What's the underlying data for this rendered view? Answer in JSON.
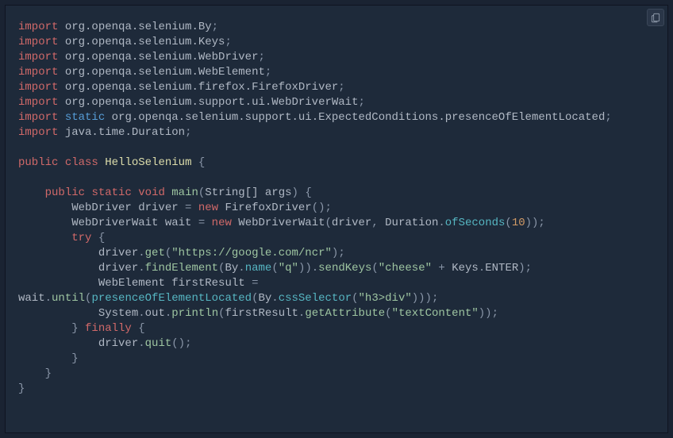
{
  "code": {
    "lines": [
      [
        {
          "c": "kw",
          "t": "import"
        },
        {
          "c": "pn",
          "t": " "
        },
        {
          "c": "pkg",
          "t": "org.openqa.selenium.By"
        },
        {
          "c": "pn",
          "t": ";"
        }
      ],
      [
        {
          "c": "kw",
          "t": "import"
        },
        {
          "c": "pn",
          "t": " "
        },
        {
          "c": "pkg",
          "t": "org.openqa.selenium.Keys"
        },
        {
          "c": "pn",
          "t": ";"
        }
      ],
      [
        {
          "c": "kw",
          "t": "import"
        },
        {
          "c": "pn",
          "t": " "
        },
        {
          "c": "pkg",
          "t": "org.openqa.selenium.WebDriver"
        },
        {
          "c": "pn",
          "t": ";"
        }
      ],
      [
        {
          "c": "kw",
          "t": "import"
        },
        {
          "c": "pn",
          "t": " "
        },
        {
          "c": "pkg",
          "t": "org.openqa.selenium.WebElement"
        },
        {
          "c": "pn",
          "t": ";"
        }
      ],
      [
        {
          "c": "kw",
          "t": "import"
        },
        {
          "c": "pn",
          "t": " "
        },
        {
          "c": "pkg",
          "t": "org.openqa.selenium.firefox.FirefoxDriver"
        },
        {
          "c": "pn",
          "t": ";"
        }
      ],
      [
        {
          "c": "kw",
          "t": "import"
        },
        {
          "c": "pn",
          "t": " "
        },
        {
          "c": "pkg",
          "t": "org.openqa.selenium.support.ui.WebDriverWait"
        },
        {
          "c": "pn",
          "t": ";"
        }
      ],
      [
        {
          "c": "kw",
          "t": "import"
        },
        {
          "c": "pn",
          "t": " "
        },
        {
          "c": "st",
          "t": "static"
        },
        {
          "c": "pn",
          "t": " "
        },
        {
          "c": "pkg",
          "t": "org.openqa.selenium.support.ui.ExpectedConditions.presenceOfElementLocated"
        },
        {
          "c": "pn",
          "t": ";"
        }
      ],
      [
        {
          "c": "kw",
          "t": "import"
        },
        {
          "c": "pn",
          "t": " "
        },
        {
          "c": "pkg",
          "t": "java.time.Duration"
        },
        {
          "c": "pn",
          "t": ";"
        }
      ],
      [],
      [
        {
          "c": "kw",
          "t": "public"
        },
        {
          "c": "pn",
          "t": " "
        },
        {
          "c": "kw",
          "t": "class"
        },
        {
          "c": "pn",
          "t": " "
        },
        {
          "c": "cls",
          "t": "HelloSelenium"
        },
        {
          "c": "pn",
          "t": " {"
        }
      ],
      [],
      [
        {
          "c": "pn",
          "t": "    "
        },
        {
          "c": "kw",
          "t": "public"
        },
        {
          "c": "pn",
          "t": " "
        },
        {
          "c": "kw",
          "t": "static"
        },
        {
          "c": "pn",
          "t": " "
        },
        {
          "c": "kw",
          "t": "void"
        },
        {
          "c": "pn",
          "t": " "
        },
        {
          "c": "mth",
          "t": "main"
        },
        {
          "c": "pn",
          "t": "("
        },
        {
          "c": "typ",
          "t": "String[] args"
        },
        {
          "c": "pn",
          "t": ") {"
        }
      ],
      [
        {
          "c": "pn",
          "t": "        "
        },
        {
          "c": "typ",
          "t": "WebDriver driver"
        },
        {
          "c": "pn",
          "t": " = "
        },
        {
          "c": "kw",
          "t": "new"
        },
        {
          "c": "pn",
          "t": " "
        },
        {
          "c": "typ",
          "t": "FirefoxDriver"
        },
        {
          "c": "pn",
          "t": "();"
        }
      ],
      [
        {
          "c": "pn",
          "t": "        "
        },
        {
          "c": "typ",
          "t": "WebDriverWait wait"
        },
        {
          "c": "pn",
          "t": " = "
        },
        {
          "c": "kw",
          "t": "new"
        },
        {
          "c": "pn",
          "t": " "
        },
        {
          "c": "typ",
          "t": "WebDriverWait"
        },
        {
          "c": "pn",
          "t": "("
        },
        {
          "c": "typ",
          "t": "driver"
        },
        {
          "c": "pn",
          "t": ", "
        },
        {
          "c": "typ",
          "t": "Duration"
        },
        {
          "c": "pn",
          "t": "."
        },
        {
          "c": "mthb",
          "t": "ofSeconds"
        },
        {
          "c": "pn",
          "t": "("
        },
        {
          "c": "num",
          "t": "10"
        },
        {
          "c": "pn",
          "t": "));"
        }
      ],
      [
        {
          "c": "pn",
          "t": "        "
        },
        {
          "c": "kw",
          "t": "try"
        },
        {
          "c": "pn",
          "t": " {"
        }
      ],
      [
        {
          "c": "pn",
          "t": "            "
        },
        {
          "c": "typ",
          "t": "driver"
        },
        {
          "c": "pn",
          "t": "."
        },
        {
          "c": "mth",
          "t": "get"
        },
        {
          "c": "pn",
          "t": "("
        },
        {
          "c": "str",
          "t": "\"https://google.com/ncr\""
        },
        {
          "c": "pn",
          "t": ");"
        }
      ],
      [
        {
          "c": "pn",
          "t": "            "
        },
        {
          "c": "typ",
          "t": "driver"
        },
        {
          "c": "pn",
          "t": "."
        },
        {
          "c": "mth",
          "t": "findElement"
        },
        {
          "c": "pn",
          "t": "("
        },
        {
          "c": "typ",
          "t": "By"
        },
        {
          "c": "pn",
          "t": "."
        },
        {
          "c": "mthb",
          "t": "name"
        },
        {
          "c": "pn",
          "t": "("
        },
        {
          "c": "str",
          "t": "\"q\""
        },
        {
          "c": "pn",
          "t": "))."
        },
        {
          "c": "mth",
          "t": "sendKeys"
        },
        {
          "c": "pn",
          "t": "("
        },
        {
          "c": "str",
          "t": "\"cheese\""
        },
        {
          "c": "pn",
          "t": " + "
        },
        {
          "c": "typ",
          "t": "Keys"
        },
        {
          "c": "pn",
          "t": "."
        },
        {
          "c": "typ",
          "t": "ENTER"
        },
        {
          "c": "pn",
          "t": ");"
        }
      ],
      [
        {
          "c": "pn",
          "t": "            "
        },
        {
          "c": "typ",
          "t": "WebElement firstResult"
        },
        {
          "c": "pn",
          "t": " ="
        }
      ],
      [
        {
          "c": "typ",
          "t": "wait"
        },
        {
          "c": "pn",
          "t": "."
        },
        {
          "c": "mth",
          "t": "until"
        },
        {
          "c": "pn",
          "t": "("
        },
        {
          "c": "mthb",
          "t": "presenceOfElementLocated"
        },
        {
          "c": "pn",
          "t": "("
        },
        {
          "c": "typ",
          "t": "By"
        },
        {
          "c": "pn",
          "t": "."
        },
        {
          "c": "mthb",
          "t": "cssSelector"
        },
        {
          "c": "pn",
          "t": "("
        },
        {
          "c": "str",
          "t": "\"h3>div\""
        },
        {
          "c": "pn",
          "t": ")));"
        }
      ],
      [
        {
          "c": "pn",
          "t": "            "
        },
        {
          "c": "typ",
          "t": "System"
        },
        {
          "c": "pn",
          "t": "."
        },
        {
          "c": "typ",
          "t": "out"
        },
        {
          "c": "pn",
          "t": "."
        },
        {
          "c": "mth",
          "t": "println"
        },
        {
          "c": "pn",
          "t": "("
        },
        {
          "c": "typ",
          "t": "firstResult"
        },
        {
          "c": "pn",
          "t": "."
        },
        {
          "c": "mth",
          "t": "getAttribute"
        },
        {
          "c": "pn",
          "t": "("
        },
        {
          "c": "str",
          "t": "\"textContent\""
        },
        {
          "c": "pn",
          "t": "));"
        }
      ],
      [
        {
          "c": "pn",
          "t": "        } "
        },
        {
          "c": "kw",
          "t": "finally"
        },
        {
          "c": "pn",
          "t": " {"
        }
      ],
      [
        {
          "c": "pn",
          "t": "            "
        },
        {
          "c": "typ",
          "t": "driver"
        },
        {
          "c": "pn",
          "t": "."
        },
        {
          "c": "mth",
          "t": "quit"
        },
        {
          "c": "pn",
          "t": "();"
        }
      ],
      [
        {
          "c": "pn",
          "t": "        }"
        }
      ],
      [
        {
          "c": "pn",
          "t": "    }"
        }
      ],
      [
        {
          "c": "pn",
          "t": "}"
        }
      ]
    ]
  }
}
